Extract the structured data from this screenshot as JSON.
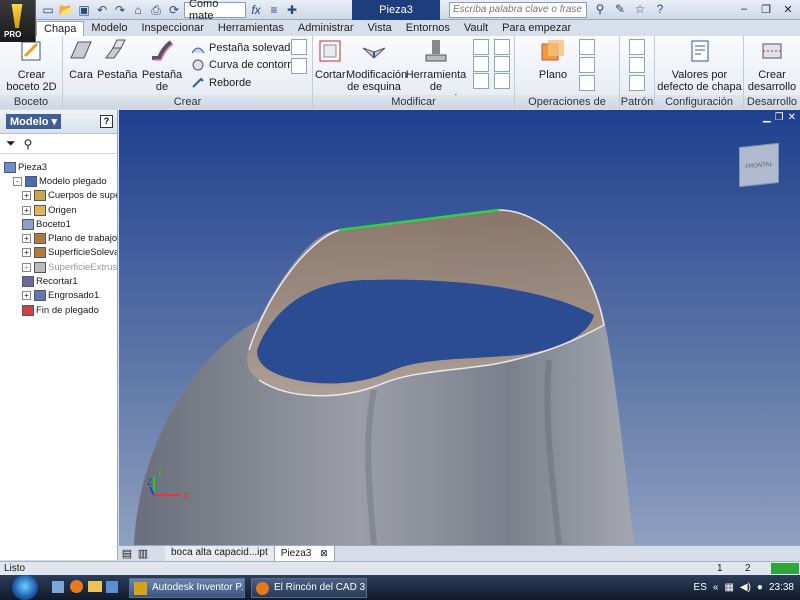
{
  "titlebar": {
    "app_badge": "PRO",
    "material_combo": "Como mate",
    "document_title": "Pieza3",
    "search_placeholder": "Escriba palabra clave o frase"
  },
  "tabs": [
    {
      "label": "Chapa",
      "active": true
    },
    {
      "label": "Modelo"
    },
    {
      "label": "Inspeccionar"
    },
    {
      "label": "Herramientas"
    },
    {
      "label": "Administrar"
    },
    {
      "label": "Vista"
    },
    {
      "label": "Entornos"
    },
    {
      "label": "Vault"
    },
    {
      "label": "Para empezar"
    }
  ],
  "ribbon": {
    "boceto": {
      "label": "Boceto",
      "crear_boceto": "Crear boceto 2D"
    },
    "crear": {
      "label": "Crear",
      "cara": "Cara",
      "pestana": "Pestaña",
      "pestana_contorno": "Pestaña de contorno",
      "pestana_solevada": "Pestaña solevada",
      "curva_contorno": "Curva de contorno",
      "reborde": "Reborde"
    },
    "modificar": {
      "label": "Modificar",
      "cortar": "Cortar",
      "modificacion_esquina": "Modificación de esquina",
      "herramienta_punzonado": "Herramienta de punzonado"
    },
    "operaciones": {
      "label": "Operaciones de trabajo",
      "plano": "Plano"
    },
    "patron": {
      "label": "Patrón"
    },
    "configuracion": {
      "label": "Configuración",
      "valores": "Valores por defecto de chapa"
    },
    "desarrollo": {
      "label": "Desarrollo",
      "crear_desarrollo": "Crear desarrollo"
    }
  },
  "browser": {
    "title": "Modelo",
    "help": "?",
    "nodes": [
      {
        "label": "Pieza3",
        "indent": 0,
        "expander": ""
      },
      {
        "label": "Modelo plegado",
        "indent": 1,
        "expander": "-"
      },
      {
        "label": "Cuerpos de supe",
        "indent": 2,
        "expander": "+"
      },
      {
        "label": "Origen",
        "indent": 2,
        "expander": "+"
      },
      {
        "label": "Boceto1",
        "indent": 2,
        "expander": ""
      },
      {
        "label": "Plano de trabajo",
        "indent": 2,
        "expander": "+"
      },
      {
        "label": "SuperficieSolevad",
        "indent": 2,
        "expander": "+"
      },
      {
        "label": "SuperficieExtrusi",
        "indent": 2,
        "expander": "+",
        "dim": true
      },
      {
        "label": "Recortar1",
        "indent": 2,
        "expander": ""
      },
      {
        "label": "Engrosado1",
        "indent": 2,
        "expander": "+"
      },
      {
        "label": "Fin de plegado",
        "indent": 2,
        "expander": ""
      }
    ]
  },
  "viewport": {
    "viewcube_label": "FRONTAL",
    "axis_x": "X",
    "axis_y": "Y",
    "axis_z": "Z"
  },
  "doc_tabs": [
    {
      "label": "boca alta capacid...ipt"
    },
    {
      "label": "Pieza3",
      "active": true,
      "close": "⊠"
    }
  ],
  "status": {
    "text": "Listo",
    "page1": "1",
    "page2": "2"
  },
  "taskbar": {
    "tasks": [
      "Autodesk Inventor P...",
      "El Rincón del CAD 3..."
    ],
    "lang": "ES",
    "clock": "23:38"
  },
  "colors": {
    "accent_title": "#1d3d7c",
    "viewport_top": "#1f3f8f",
    "highlight_edge": "#2ed14a"
  }
}
